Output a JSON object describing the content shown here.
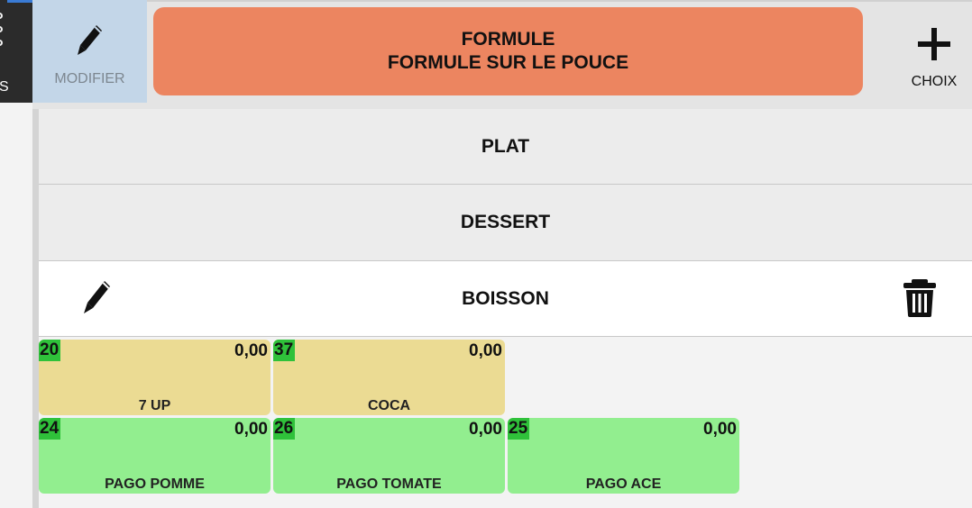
{
  "sidebar": {
    "partial_label": "S"
  },
  "header": {
    "modify_label": "MODIFIER",
    "formula_line1": "FORMULE",
    "formula_line2": "FORMULE SUR LE POUCE",
    "choice_label": "CHOIX"
  },
  "categories": [
    {
      "label": "PLAT"
    },
    {
      "label": "DESSERT"
    },
    {
      "label": "BOISSON"
    }
  ],
  "products": [
    {
      "code": "20",
      "price": "0,00",
      "name": "7 UP",
      "color": "#ebdb93"
    },
    {
      "code": "37",
      "price": "0,00",
      "name": "COCA",
      "color": "#ebdb93"
    },
    {
      "code": "24",
      "price": "0,00",
      "name": "PAGO POMME",
      "color": "#92ee8f"
    },
    {
      "code": "26",
      "price": "0,00",
      "name": "PAGO TOMATE",
      "color": "#92ee8f"
    },
    {
      "code": "25",
      "price": "0,00",
      "name": "PAGO ACE",
      "color": "#92ee8f"
    }
  ],
  "icons": {
    "modify": "pencil-icon",
    "choice": "plus-icon",
    "category_edit": "pencil-icon",
    "category_delete": "trash-icon"
  },
  "colors": {
    "formula_bg": "#ec8560",
    "modify_bg": "#c3d6e8",
    "code_badge": "#2fc13a"
  }
}
